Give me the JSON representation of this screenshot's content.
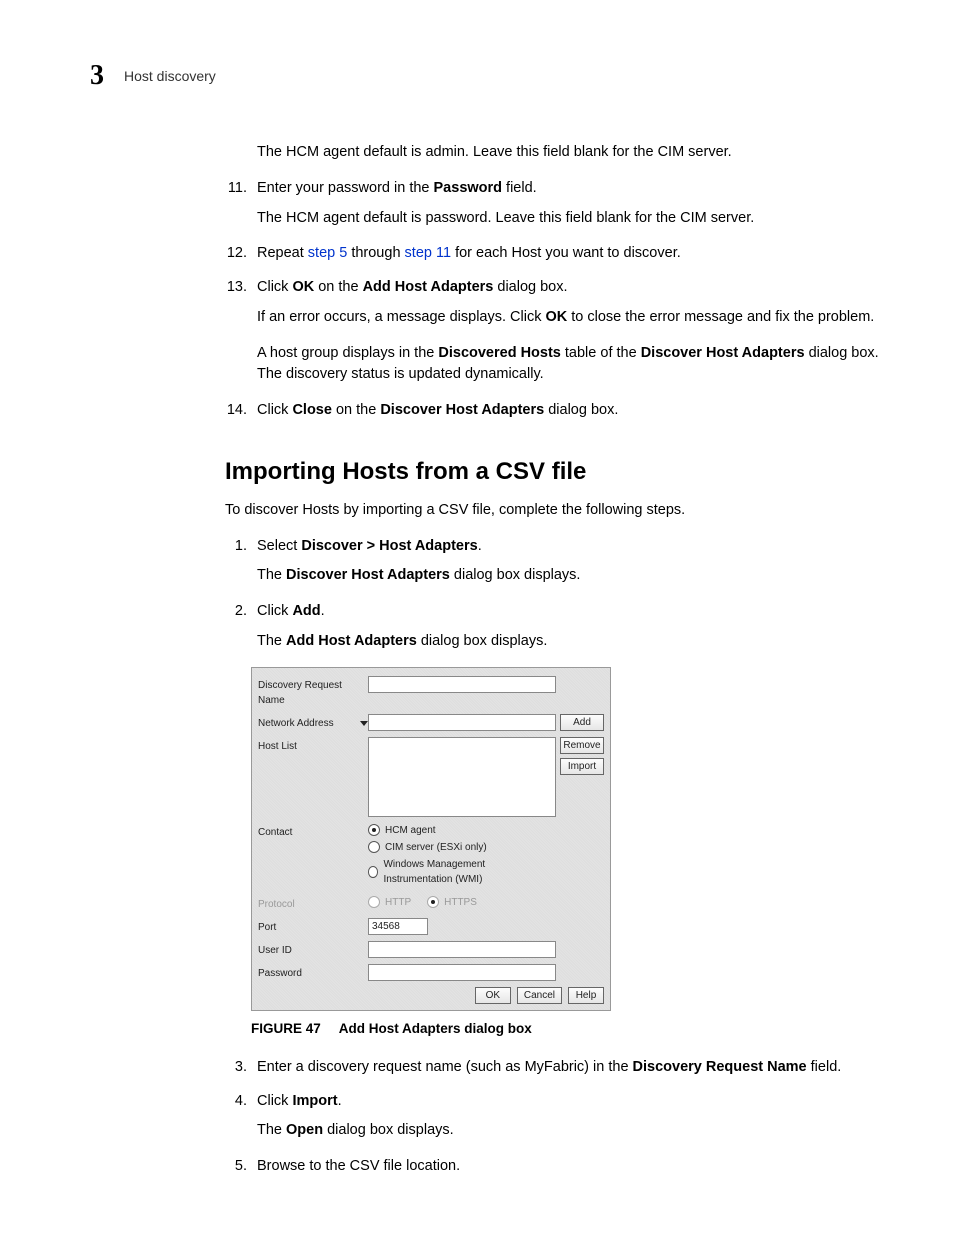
{
  "header": {
    "chapter": "3",
    "section": "Host discovery"
  },
  "top_paragraph": "The HCM agent default is admin. Leave this field blank for the CIM server.",
  "list1": {
    "i11_a": "Enter your password in the ",
    "i11_b": "Password",
    "i11_c": " field.",
    "i11_sub": "The HCM agent default is password. Leave this field blank for the CIM server.",
    "i12_a": "Repeat ",
    "i12_b": "step 5",
    "i12_c": " through ",
    "i12_d": "step 11",
    "i12_e": " for each Host you want to discover.",
    "i13_a": "Click ",
    "i13_b": "OK",
    "i13_c": " on the ",
    "i13_d": "Add Host Adapters",
    "i13_e": " dialog box.",
    "i13_sub1a": "If an error occurs, a message displays. Click ",
    "i13_sub1b": "OK",
    "i13_sub1c": " to close the error message and fix the problem.",
    "i13_sub2a": "A host group displays in the ",
    "i13_sub2b": "Discovered Hosts",
    "i13_sub2c": " table of the ",
    "i13_sub2d": "Discover Host Adapters",
    "i13_sub2e": " dialog box. The discovery status is updated dynamically.",
    "i14_a": "Click ",
    "i14_b": "Close",
    "i14_c": " on the ",
    "i14_d": "Discover Host Adapters",
    "i14_e": " dialog box."
  },
  "subsection_title": "Importing Hosts from a CSV file",
  "intro2": "To discover Hosts by importing a CSV file, complete the following steps.",
  "list2": {
    "i1_a": "Select ",
    "i1_b": "Discover > Host Adapters",
    "i1_c": ".",
    "i1_sub_a": "The ",
    "i1_sub_b": "Discover Host Adapters",
    "i1_sub_c": " dialog box displays.",
    "i2_a": "Click ",
    "i2_b": "Add",
    "i2_c": ".",
    "i2_sub_a": "The ",
    "i2_sub_b": "Add Host Adapters",
    "i2_sub_c": " dialog box displays.",
    "i3_a": "Enter a discovery request name (such as MyFabric) in the ",
    "i3_b": "Discovery Request Name",
    "i3_c": " field.",
    "i4_a": "Click ",
    "i4_b": "Import",
    "i4_c": ".",
    "i4_sub_a": "The ",
    "i4_sub_b": "Open",
    "i4_sub_c": " dialog box displays.",
    "i5": "Browse to the CSV file location."
  },
  "dialog": {
    "discovery_request_name": "Discovery Request Name",
    "network_address": "Network Address",
    "add": "Add",
    "host_list": "Host List",
    "remove": "Remove",
    "import": "Import",
    "contact": "Contact",
    "hcm_agent": "HCM agent",
    "cim": "CIM server (ESXi only)",
    "wmi": "Windows Management Instrumentation (WMI)",
    "protocol": "Protocol",
    "http": "HTTP",
    "https": "HTTPS",
    "port": "Port",
    "port_value": "34568",
    "user_id": "User ID",
    "password": "Password",
    "ok": "OK",
    "cancel": "Cancel",
    "help": "Help"
  },
  "figure": {
    "label": "FIGURE 47",
    "caption": "Add Host Adapters dialog box"
  }
}
